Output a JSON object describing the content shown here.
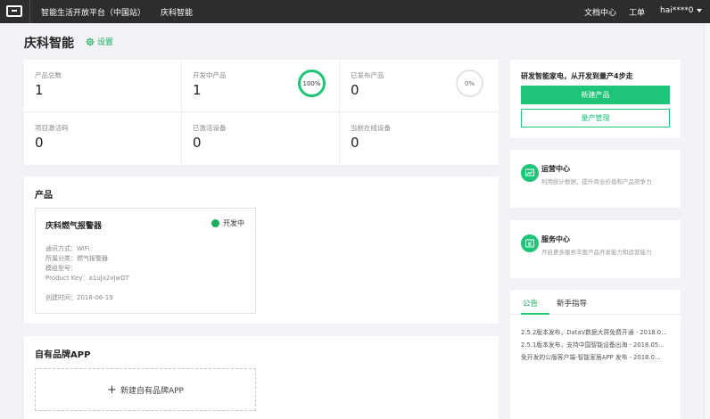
{
  "topbar": {
    "platform": "智能生活开放平台（中国站）",
    "company": "庆科智能",
    "docs": "文档中心",
    "ticket": "工单",
    "user": "hai****0"
  },
  "page": {
    "title": "庆科智能",
    "settings": "设置"
  },
  "stats": [
    {
      "label": "产品总数",
      "value": "1"
    },
    {
      "label": "开发中产品",
      "value": "1",
      "ring": "100%"
    },
    {
      "label": "已发布产品",
      "value": "0",
      "ring": "0%"
    },
    {
      "label": "项目激活码",
      "value": "0"
    },
    {
      "label": "已激活设备",
      "value": "0"
    },
    {
      "label": "当前在线设备",
      "value": "0"
    }
  ],
  "products": {
    "title": "产品",
    "card": {
      "name": "庆科燃气报警器",
      "status": "开发中",
      "protocol": "通讯方式：WiFi",
      "category": "所属分类：燃气报警器",
      "model": "模组型号：",
      "product_key": "Product Key：a1uJx2vJwDT",
      "created": "创建时间：2018-06-19"
    }
  },
  "apps": {
    "title": "自有品牌APP",
    "new_label": "新建自有品牌APP"
  },
  "quick": {
    "head": "研发智能家电，从开发到量产4步走",
    "new_product": "新建产品",
    "mass_production": "量产管理"
  },
  "ops": {
    "title": "运营中心",
    "desc": "利用统计数据，提升商业价值和产品竞争力"
  },
  "service": {
    "title": "服务中心",
    "desc": "开启更多服务丰富产品开发能力和运营能力"
  },
  "notice": {
    "tabs": [
      "公告",
      "新手指导"
    ],
    "items": [
      "2.5.2版本发布，DataV数据大屏免费开通 - 2018.0…",
      "2.5.1版本发布，支持中国智能设备出海 - 2018.05…",
      "免开发的公版客户端-智能家居APP 发布 - 2018.0…"
    ]
  },
  "colors": {
    "accent": "#1ec478",
    "topbar": "#2d2d2d"
  }
}
